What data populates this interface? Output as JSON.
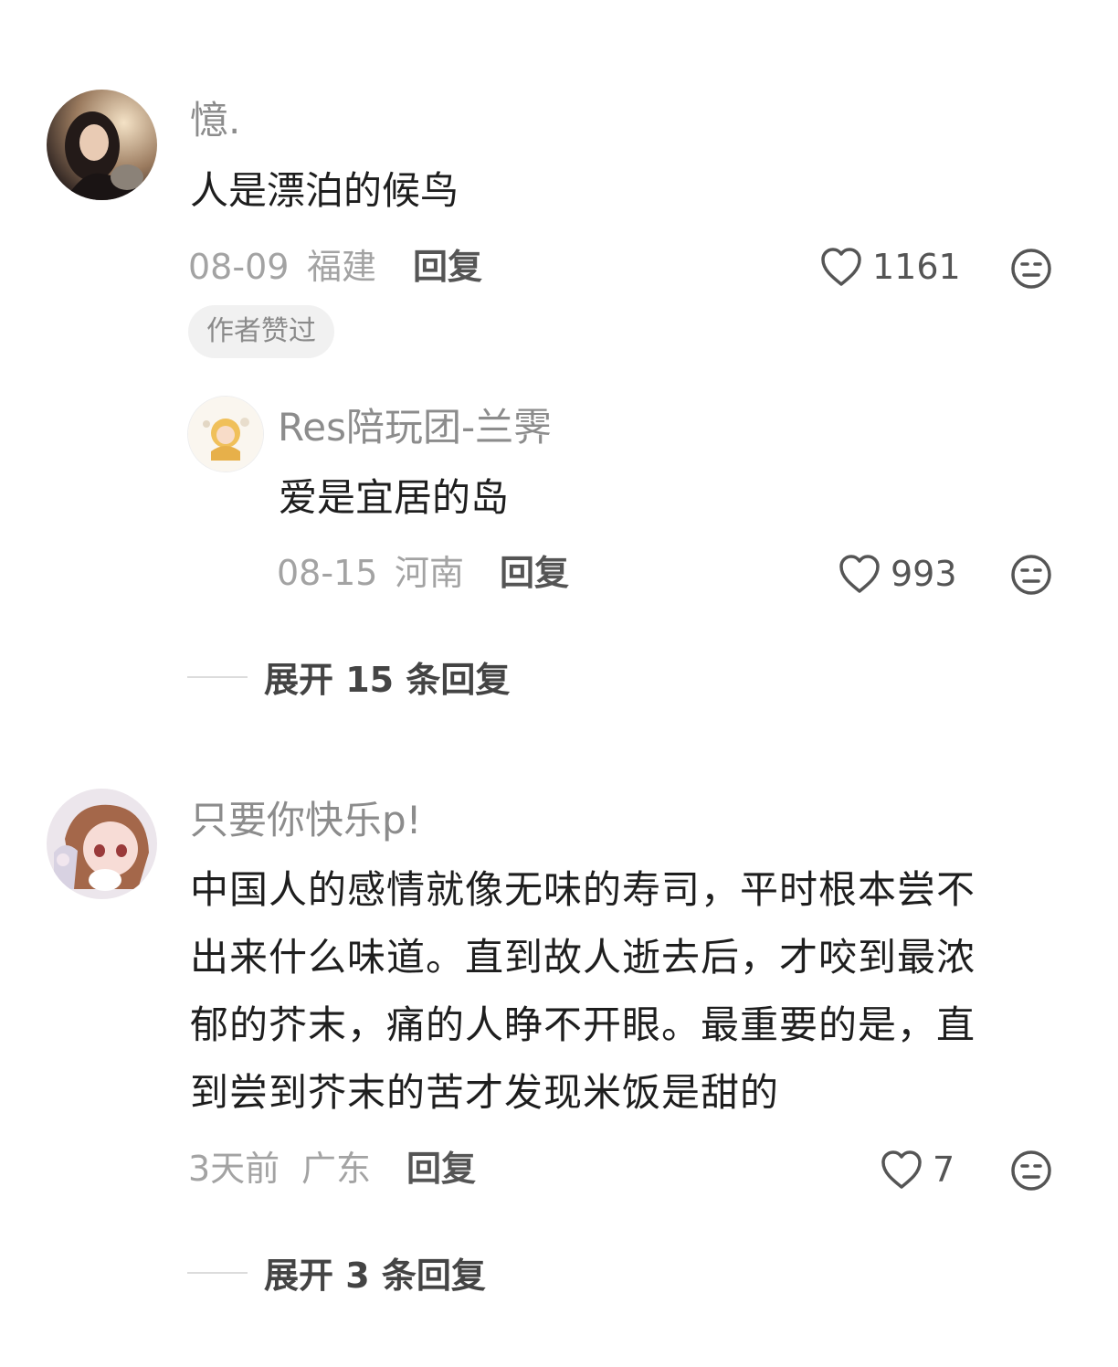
{
  "comments": [
    {
      "username": "憶.",
      "text": "人是漂泊的候鸟",
      "date": "08-09",
      "location": "福建",
      "reply_label": "回复",
      "likes": "1161",
      "badge": "作者赞过",
      "replies": [
        {
          "username": "Res陪玩团-兰霁",
          "text": "爱是宜居的岛",
          "date": "08-15",
          "location": "河南",
          "reply_label": "回复",
          "likes": "993"
        }
      ],
      "expand_label": "展开 15 条回复"
    },
    {
      "username": "只要你快乐p!",
      "text_lines": [
        "中国人的感情就像无味的寿司，平时根本尝不",
        "出来什么味道。直到故人逝去后，才咬到最浓",
        "郁的芥末，痛的人睁不开眼。最重要的是，直",
        "到尝到芥末的苦才发现米饭是甜的"
      ],
      "date": "3天前",
      "location": "广东",
      "reply_label": "回复",
      "likes": "7",
      "expand_label": "展开 3 条回复"
    }
  ],
  "icons": {
    "like": "heart-outline-icon",
    "dislike": "meh-face-icon"
  },
  "colors": {
    "username": "#8c8c8c",
    "meta": "#a3a3a3",
    "badge_bg": "#f1f1f1"
  }
}
